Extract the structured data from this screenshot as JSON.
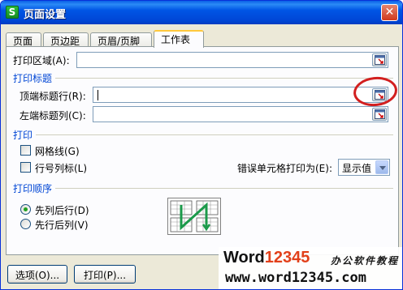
{
  "window": {
    "title": "页面设置",
    "app_icon": "S",
    "close_symbol": "✕"
  },
  "tabs": [
    {
      "label": "页面",
      "active": false
    },
    {
      "label": "页边距",
      "active": false
    },
    {
      "label": "页眉/页脚",
      "active": false
    },
    {
      "label": "工作表",
      "active": true
    }
  ],
  "print_area": {
    "label": "打印区域(A):",
    "value": ""
  },
  "print_titles": {
    "group_title": "打印标题",
    "top_rows_label": "顶端标题行(R):",
    "top_rows_value": "",
    "left_cols_label": "左端标题列(C):",
    "left_cols_value": ""
  },
  "print": {
    "group_title": "打印",
    "gridlines_label": "网格线(G)",
    "gridlines_checked": false,
    "row_col_headers_label": "行号列标(L)",
    "row_col_headers_checked": false,
    "cell_errors_label": "错误单元格打印为(E):",
    "cell_errors_value": "显示值"
  },
  "page_order": {
    "group_title": "打印顺序",
    "down_then_over_label": "先列后行(D)",
    "over_then_down_label": "先行后列(V)",
    "selected": "down_then_over"
  },
  "buttons": {
    "options": "选项(O)...",
    "print": "打印(P)..."
  },
  "watermark": {
    "logo_word": "Word",
    "logo_num": "12345",
    "tagline": "办公软件教程",
    "url": "www.word12345.com"
  },
  "colors": {
    "group_title": "#0046d5",
    "highlight_ring": "#d21f1f",
    "title_bar": "#0055e5"
  },
  "icons": [
    "collapse-dialog-icon",
    "page-order-diagram-icon"
  ]
}
